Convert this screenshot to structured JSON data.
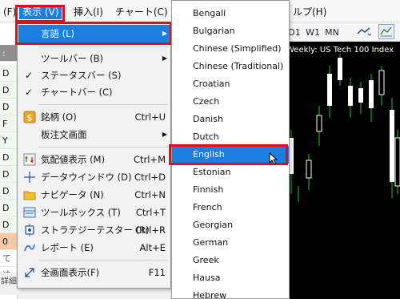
{
  "menubar": {
    "file_fragment": "(F)",
    "view": "表示 (V)",
    "insert": "挿入(I)",
    "chart": "チャート(C)",
    "help_fragment": "ルプ(H)"
  },
  "toolbar": {
    "tf1": "D1",
    "tf2": "W1",
    "tf3": "MN"
  },
  "chart": {
    "title": "Weekly:  US Tech 100 Index"
  },
  "left_strip": {
    "head": ": 09",
    "cells": [
      "D",
      "D",
      "D",
      "F",
      "Y",
      "D",
      "D",
      "D",
      "D",
      "D",
      "D",
      "D"
    ],
    "orange_cell": "0",
    "bottom_text": "て追",
    "footer": "詳細"
  },
  "view_menu": {
    "items": [
      {
        "label": "言語 (L)",
        "shortcut": "",
        "submenu": true,
        "highlighted": true
      },
      {
        "label": "ツールバー (B)",
        "shortcut": "",
        "submenu": true
      },
      {
        "label": "ステータスバー (S)",
        "shortcut": "",
        "checked": true
      },
      {
        "label": "チャートバー (C)",
        "shortcut": "",
        "checked": true
      },
      {
        "label": "銘柄 (O)",
        "shortcut": "Ctrl+U",
        "icon": "dollar-icon"
      },
      {
        "label": "板注文画面",
        "shortcut": "",
        "submenu": true
      },
      {
        "label": "気配値表示 (M)",
        "shortcut": "Ctrl+M",
        "icon": "market-watch-icon"
      },
      {
        "label": "データウインドウ (D)",
        "shortcut": "Ctrl+D",
        "icon": "crosshair-icon"
      },
      {
        "label": "ナビゲータ (N)",
        "shortcut": "Ctrl+N",
        "icon": "folder-icon"
      },
      {
        "label": "ツールボックス (T)",
        "shortcut": "Ctrl+T",
        "icon": "toolbox-icon"
      },
      {
        "label": "ストラテジーテスター (R)",
        "shortcut": "Ctrl+R",
        "icon": "tester-icon"
      },
      {
        "label": "レポート (E)",
        "shortcut": "Alt+E",
        "icon": "report-icon"
      },
      {
        "label": "全画面表示(F)",
        "shortcut": "F11",
        "icon": "fullscreen-icon"
      }
    ]
  },
  "language_menu": {
    "items": [
      "Bengali",
      "Bulgarian",
      "Chinese (Simplified)",
      "Chinese (Traditional)",
      "Croatian",
      "Czech",
      "Danish",
      "Dutch",
      "English",
      "Estonian",
      "Finnish",
      "French",
      "Georgian",
      "German",
      "Greek",
      "Hausa",
      "Hebrew"
    ],
    "selected": "English"
  },
  "colors": {
    "highlight": "#1c7fe0",
    "annotation": "#e0101a",
    "candle_up": "#ffffff",
    "wick": "#26c426"
  }
}
